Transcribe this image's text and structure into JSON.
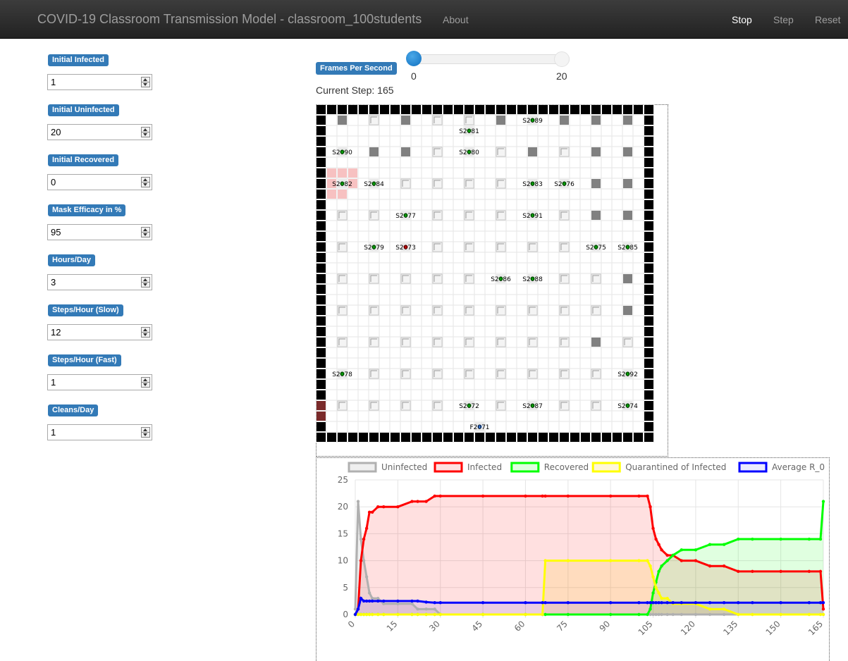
{
  "navbar": {
    "title": "COVID-19 Classroom Transmission Model - classroom_100students",
    "about": "About",
    "stop": "Stop",
    "step": "Step",
    "reset": "Reset"
  },
  "params": [
    {
      "label": "Initial Infected",
      "value": "1"
    },
    {
      "label": "Initial Uninfected",
      "value": "20"
    },
    {
      "label": "Initial Recovered",
      "value": "0"
    },
    {
      "label": "Mask Efficacy in %",
      "value": "95"
    },
    {
      "label": "Hours/Day",
      "value": "3"
    },
    {
      "label": "Steps/Hour (Slow)",
      "value": "12"
    },
    {
      "label": "Steps/Hour (Fast)",
      "value": "1"
    },
    {
      "label": "Cleans/Day",
      "value": "1"
    }
  ],
  "fps": {
    "label": "Frames Per Second",
    "min": "0",
    "max": "20",
    "value": 0
  },
  "current_step": "Current Step: 165",
  "grid": {
    "colors": {
      "wall": "#000000",
      "seat_occupied": "#808080",
      "student_uninfected": "#00aa00",
      "student_infected": "#cc0000",
      "aerosol": "#f7c1c1"
    },
    "students": [
      {
        "label": "S2081",
        "status": "recovered"
      },
      {
        "label": "S2089",
        "status": "recovered"
      },
      {
        "label": "S2090",
        "status": "recovered"
      },
      {
        "label": "S2080",
        "status": "recovered"
      },
      {
        "label": "S2082",
        "status": "recovered"
      },
      {
        "label": "S2084",
        "status": "recovered"
      },
      {
        "label": "S2083",
        "status": "recovered"
      },
      {
        "label": "S2076",
        "status": "recovered"
      },
      {
        "label": "S2077",
        "status": "recovered"
      },
      {
        "label": "S2091",
        "status": "recovered"
      },
      {
        "label": "S2079",
        "status": "recovered"
      },
      {
        "label": "S2073",
        "status": "infected"
      },
      {
        "label": "S2075",
        "status": "recovered"
      },
      {
        "label": "S2085",
        "status": "recovered"
      },
      {
        "label": "S2086",
        "status": "recovered"
      },
      {
        "label": "S2088",
        "status": "recovered"
      },
      {
        "label": "S2078",
        "status": "recovered"
      },
      {
        "label": "S2092",
        "status": "recovered"
      },
      {
        "label": "S2072",
        "status": "recovered"
      },
      {
        "label": "S2087",
        "status": "recovered"
      },
      {
        "label": "S2074",
        "status": "recovered"
      },
      {
        "label": "F2071",
        "status": "faculty"
      }
    ]
  },
  "chart_data": {
    "type": "line",
    "x": [
      0,
      1,
      2,
      3,
      4,
      5,
      6,
      8,
      10,
      15,
      20,
      22,
      25,
      28,
      30,
      45,
      60,
      66,
      67,
      75,
      90,
      100,
      103,
      104,
      105,
      106,
      107,
      108,
      110,
      112,
      115,
      120,
      125,
      130,
      135,
      140,
      150,
      160,
      164,
      165
    ],
    "x_ticks": [
      "0",
      "15",
      "30",
      "45",
      "60",
      "75",
      "90",
      "105",
      "120",
      "135",
      "150",
      "165"
    ],
    "y_ticks": [
      "0",
      "5",
      "10",
      "15",
      "20",
      "25"
    ],
    "ylim": [
      0,
      25
    ],
    "xlim": [
      0,
      165
    ],
    "legend_position": "top",
    "series": [
      {
        "name": "Uninfected",
        "color": "#b0b0b0",
        "fill": "rgba(176,176,176,0.2)",
        "values": [
          1,
          21,
          14,
          10,
          7,
          4,
          3,
          3,
          2,
          2,
          2,
          1,
          1,
          1,
          0,
          0,
          0,
          0,
          0,
          0,
          0,
          0,
          0,
          0,
          0,
          0,
          0,
          0,
          0,
          0,
          0,
          0,
          0,
          0,
          0,
          0,
          0,
          0,
          0,
          0
        ]
      },
      {
        "name": "Infected",
        "color": "#ff0000",
        "fill": "rgba(255,0,0,0.12)",
        "values": [
          0,
          1,
          10,
          14,
          16,
          19,
          19,
          20,
          20,
          20,
          21,
          21,
          21,
          22,
          22,
          22,
          22,
          22,
          22,
          22,
          22,
          22,
          22,
          20,
          16,
          14,
          13,
          12,
          11,
          11,
          10,
          10,
          9,
          9,
          8,
          8,
          8,
          8,
          8,
          1
        ]
      },
      {
        "name": "Recovered",
        "color": "#00ff00",
        "fill": "rgba(0,255,0,0.12)",
        "values": [
          0,
          0,
          0,
          0,
          0,
          0,
          0,
          0,
          0,
          0,
          0,
          0,
          0,
          0,
          0,
          0,
          0,
          0,
          0,
          0,
          0,
          0,
          0,
          1,
          4,
          6,
          8,
          9,
          10,
          11,
          12,
          12,
          13,
          13,
          14,
          14,
          14,
          14,
          14,
          21
        ]
      },
      {
        "name": "Quarantined of Infected",
        "color": "#ffff00",
        "fill": "rgba(255,200,0,0.15)",
        "values": [
          0,
          0,
          0,
          0,
          0,
          0,
          0,
          0,
          0,
          0,
          0,
          0,
          0,
          0,
          0,
          0,
          0,
          0,
          10,
          10,
          10,
          10,
          10,
          9,
          7,
          5,
          4,
          3,
          3,
          2,
          2,
          2,
          1,
          1,
          0,
          0,
          0,
          0,
          0,
          0
        ]
      },
      {
        "name": "Average R_0",
        "color": "#0000ff",
        "fill": "rgba(0,0,255,0.08)",
        "values": [
          0,
          1,
          3,
          2.5,
          2.5,
          2.5,
          2.5,
          2.5,
          2.5,
          2.5,
          2.5,
          2.5,
          2.3,
          2.2,
          2.2,
          2.2,
          2.2,
          2.2,
          2.2,
          2.2,
          2.2,
          2.2,
          2.2,
          2.2,
          2.2,
          2.2,
          2.2,
          2.2,
          2.2,
          2.2,
          2.2,
          2.2,
          2.2,
          2.2,
          2.2,
          2.2,
          2.2,
          2.2,
          2.2,
          2.2
        ]
      }
    ]
  }
}
